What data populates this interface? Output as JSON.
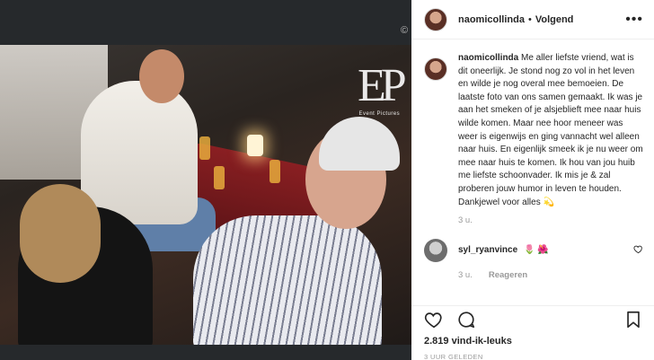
{
  "post": {
    "username": "naomicollinda",
    "follow_separator": "•",
    "follow_status": "Volgend",
    "more_icon": "more-horizontal-icon",
    "copyright_symbol": "©"
  },
  "photo": {
    "watermark_caption": "Event Pictures"
  },
  "caption": {
    "username": "naomicollinda",
    "text": "Me aller liefste vriend, wat is dit oneerlijk. Je stond nog zo vol in het leven en wilde je nog overal mee bemoeien. De laatste foto van ons samen gemaakt. Ik was je aan het smeken of je alsjeblieft mee naar huis wilde komen. Maar nee hoor meneer was weer is eigenwijs en ging vannacht wel alleen naar huis. En eigenlijk smeek ik je nu weer om mee naar huis te komen. Ik hou van jou huib me liefste schoonvader. Ik mis je & zal proberen jouw humor in leven te houden. Dankjewel voor alles 💫",
    "time": "3 u."
  },
  "comment": {
    "username": "syl_ryanvince",
    "text": "🌷 🌺",
    "time": "3 u.",
    "reply_label": "Reageren"
  },
  "actions": {
    "like_icon": "heart-icon",
    "comment_icon": "comment-icon",
    "save_icon": "bookmark-icon"
  },
  "likes_text": "2.819 vind-ik-leuks",
  "posted_text": "3 UUR GELEDEN"
}
